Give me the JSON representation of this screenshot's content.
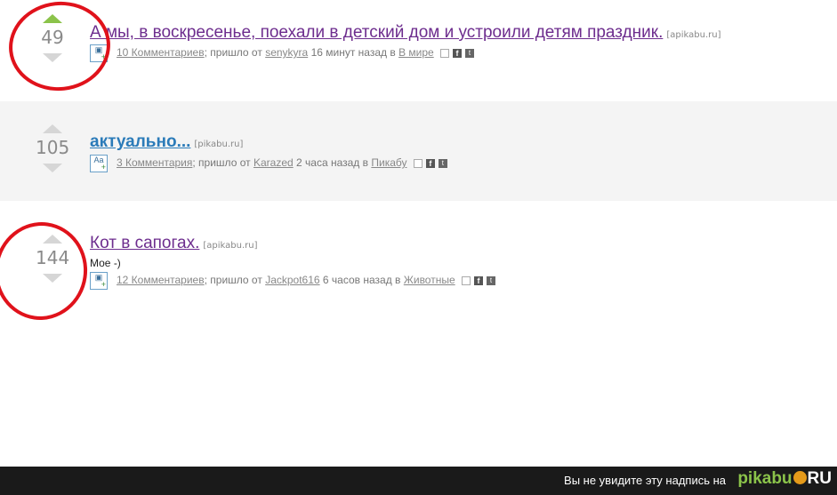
{
  "posts": [
    {
      "score": "49",
      "title": "А мы, в воскресенье, поехали в детский дом и устроили детям праздник.",
      "source": "[apikabu.ru]",
      "comments": "10 Комментариев",
      "prefix": "; пришло от",
      "author": "senykyra",
      "time": "16 минут назад в",
      "category": "В мире"
    },
    {
      "score": "105",
      "title": "актуально...",
      "source": "[pikabu.ru]",
      "comments": "3 Комментария",
      "prefix": "; пришло от",
      "author": "Karazed",
      "time": "2 часа назад в",
      "category": "Пикабу"
    },
    {
      "score": "144",
      "title": "Кот в сапогах.",
      "source": "[apikabu.ru]",
      "excerpt": "Мое -)",
      "comments": "12 Комментариев",
      "prefix": "; пришло от",
      "author": "Jackpot616",
      "time": "6 часов назад в",
      "category": "Животные"
    }
  ],
  "icons": {
    "text_type": "Aa",
    "plus": "+",
    "fb": "f",
    "tw": "t"
  },
  "footer": {
    "text": "Вы не увидите эту надпись на",
    "logo_main": "pikabu",
    "logo_suffix": "RU"
  },
  "colors": {
    "accent_green": "#8bc34a",
    "annotation_red": "#e0121b",
    "title_purple": "#6d2d8e",
    "title_blue": "#2b7bb9"
  }
}
